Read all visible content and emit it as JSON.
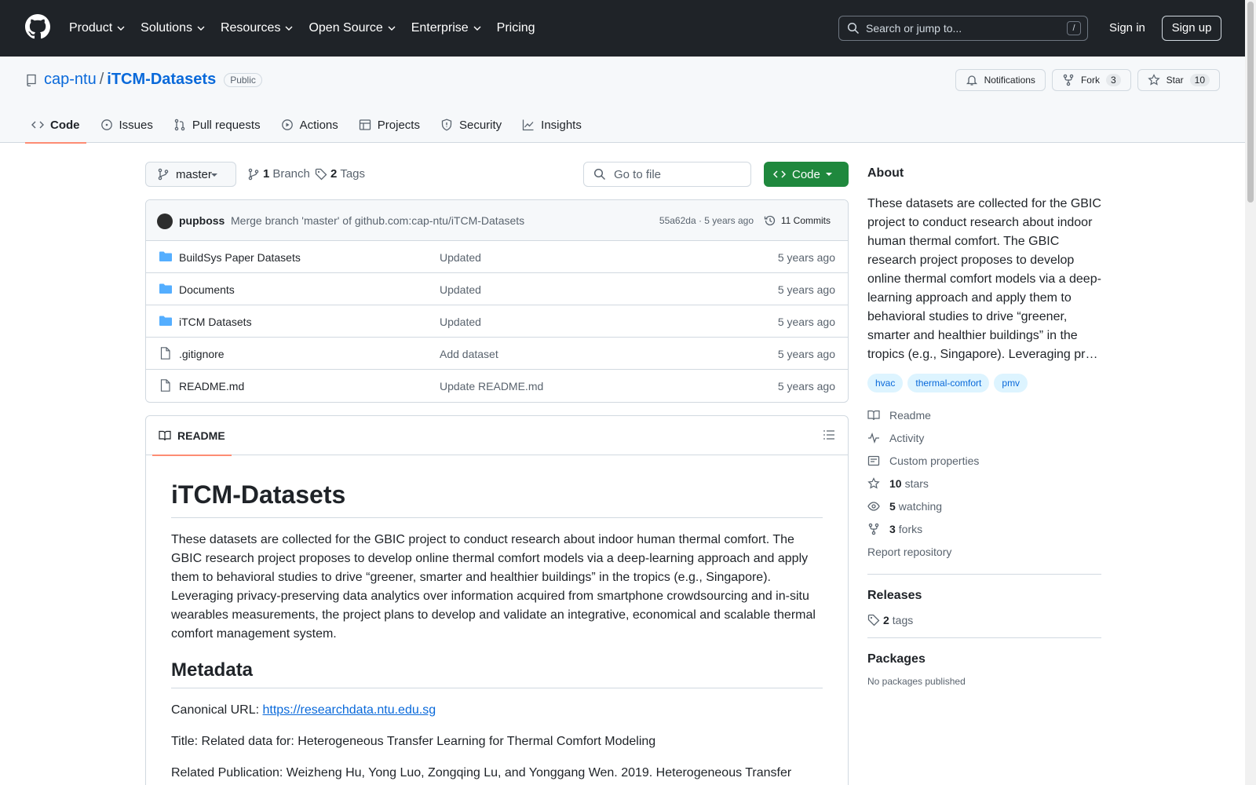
{
  "header": {
    "nav": [
      "Product",
      "Solutions",
      "Resources",
      "Open Source",
      "Enterprise",
      "Pricing"
    ],
    "search_placeholder": "Search or jump to...",
    "search_shortcut": "/",
    "sign_in": "Sign in",
    "sign_up": "Sign up"
  },
  "repo": {
    "owner": "cap-ntu",
    "separator": "/",
    "name": "iTCM-Datasets",
    "visibility": "Public",
    "notifications_label": "Notifications",
    "fork_label": "Fork",
    "fork_count": "3",
    "star_label": "Star",
    "star_count": "10",
    "tabs": [
      "Code",
      "Issues",
      "Pull requests",
      "Actions",
      "Projects",
      "Security",
      "Insights"
    ]
  },
  "toolbar": {
    "branch": "master",
    "branch_count": "1",
    "branch_label": "Branch",
    "tag_count": "2",
    "tag_label": "Tags",
    "goto_placeholder": "Go to file",
    "code_label": "Code"
  },
  "commit": {
    "author": "pupboss",
    "message": "Merge branch 'master' of github.com:cap-ntu/iTCM-Datasets",
    "meta": "55a62da · 5 years ago",
    "count_label": "11 Commits"
  },
  "files": [
    {
      "name": "BuildSys Paper Datasets",
      "type": "folder",
      "message": "Updated",
      "date": "5 years ago"
    },
    {
      "name": "Documents",
      "type": "folder",
      "message": "Updated",
      "date": "5 years ago"
    },
    {
      "name": "iTCM Datasets",
      "type": "folder",
      "message": "Updated",
      "date": "5 years ago"
    },
    {
      "name": ".gitignore",
      "type": "file",
      "message": "Add dataset",
      "date": "5 years ago"
    },
    {
      "name": "README.md",
      "type": "file",
      "message": "Update README.md",
      "date": "5 years ago"
    }
  ],
  "readme": {
    "tab_label": "README",
    "h1": "iTCM-Datasets",
    "intro": "These datasets are collected for the GBIC project to conduct research about indoor human thermal comfort. The GBIC research project proposes to develop online thermal comfort models via a deep-learning approach and apply them to behavioral studies to drive “greener, smarter and healthier buildings” in the tropics (e.g., Singapore). Leveraging privacy-preserving data analytics over information acquired from smartphone crowdsourcing and in-situ wearables measurements, the project plans to develop and validate an integrative, economical and scalable thermal comfort management system.",
    "h2": "Metadata",
    "canonical_label": "Canonical URL: ",
    "canonical_url": "https://researchdata.ntu.edu.sg",
    "title_line": "Title: Related data for: Heterogeneous Transfer Learning for Thermal Comfort Modeling",
    "publication_line": "Related Publication: Weizheng Hu, Yong Luo, Zongqing Lu, and Yonggang Wen. 2019. Heterogeneous Transfer"
  },
  "sidebar": {
    "about_title": "About",
    "about_text": "These datasets are collected for the GBIC project to conduct research about indoor human thermal comfort. The GBIC research project proposes to develop online thermal comfort models via a deep-learning approach and apply them to behavioral studies to drive “greener, smarter and healthier buildings” in the tropics (e.g., Singapore). Leveraging pr…",
    "topics": [
      "hvac",
      "thermal-comfort",
      "pmv"
    ],
    "readme": "Readme",
    "activity": "Activity",
    "custom_properties": "Custom properties",
    "stars_count": "10",
    "stars_label": "stars",
    "watching_count": "5",
    "watching_label": "watching",
    "forks_count": "3",
    "forks_label": "forks",
    "report": "Report repository",
    "releases_title": "Releases",
    "release_tags_count": "2",
    "release_tags_label": "tags",
    "packages_title": "Packages",
    "packages_text": "No packages published"
  }
}
